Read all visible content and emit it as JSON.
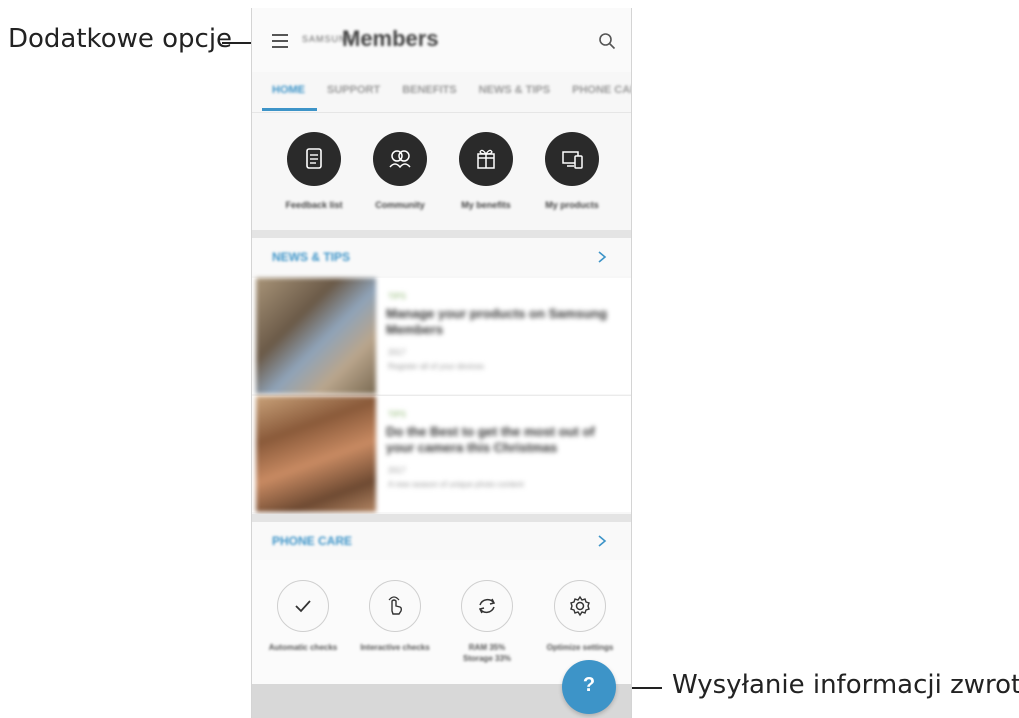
{
  "callouts": {
    "left": "Dodatkowe opcje",
    "right": "Wysyłanie informacji zwrotnej."
  },
  "appbar": {
    "logo_prefix": "SAMSUNG",
    "title": "Members",
    "menu_icon": "hamburger-menu-icon",
    "search_icon": "search-icon"
  },
  "tabs": [
    {
      "label": "HOME",
      "active": true
    },
    {
      "label": "SUPPORT",
      "active": false
    },
    {
      "label": "BENEFITS",
      "active": false
    },
    {
      "label": "NEWS & TIPS",
      "active": false
    },
    {
      "label": "PHONE CARE",
      "active": false
    }
  ],
  "quick_actions": [
    {
      "label": "Feedback list",
      "icon": "document-icon"
    },
    {
      "label": "Community",
      "icon": "community-icon"
    },
    {
      "label": "My benefits",
      "icon": "gift-icon"
    },
    {
      "label": "My products",
      "icon": "devices-icon"
    }
  ],
  "news_section": {
    "title": "NEWS & TIPS",
    "items": [
      {
        "tag": "TIPS",
        "title": "Manage your products on Samsung Members",
        "meta": "2017",
        "meta2": "Register all of your devices"
      },
      {
        "tag": "TIPS",
        "title": "Do the Best to get the most out of your camera this Christmas",
        "meta": "2017",
        "meta2": "A new season of unique photo content"
      }
    ]
  },
  "phone_care": {
    "title": "PHONE CARE",
    "items": [
      {
        "label": "Automatic checks",
        "label2": "",
        "icon": "checkmark-icon"
      },
      {
        "label": "Interactive checks",
        "label2": "",
        "icon": "touch-icon"
      },
      {
        "label": "RAM 35%",
        "label2": "Storage 33%",
        "icon": "refresh-icon"
      },
      {
        "label": "Optimize settings",
        "label2": "",
        "icon": "settings-icon"
      }
    ]
  },
  "fab": {
    "label": "?",
    "icon": "feedback-icon"
  },
  "colors": {
    "accent": "#3d94c8",
    "dark_circle": "#2a2a2a",
    "divider": "#e4e4e4",
    "tag_green": "#8ab56d"
  }
}
